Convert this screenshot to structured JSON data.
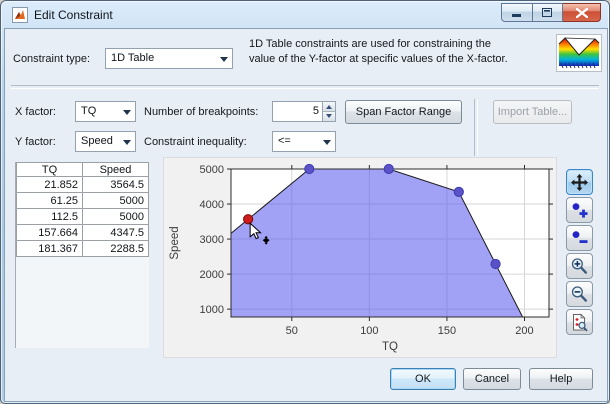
{
  "window": {
    "title": "Edit Constraint"
  },
  "header": {
    "constraint_type_label": "Constraint type:",
    "constraint_type_value": "1D Table",
    "description_line1": "1D Table constraints are used for constraining the",
    "description_line2": "value of the Y-factor at specific values of the X-factor."
  },
  "controls": {
    "x_factor_label": "X factor:",
    "x_factor_value": "TQ",
    "y_factor_label": "Y factor:",
    "y_factor_value": "Speed",
    "breakpoints_label": "Number of breakpoints:",
    "breakpoints_value": "5",
    "inequality_label": "Constraint inequality:",
    "inequality_value": "<=",
    "span_button": "Span Factor Range",
    "import_button": "Import Table..."
  },
  "table": {
    "headers": [
      "TQ",
      "Speed"
    ],
    "rows": [
      [
        "21.852",
        "3564.5"
      ],
      [
        "61.25",
        "5000"
      ],
      [
        "112.5",
        "5000"
      ],
      [
        "157.664",
        "4347.5"
      ],
      [
        "181.367",
        "2288.5"
      ]
    ]
  },
  "chart_data": {
    "type": "area",
    "xlabel": "TQ",
    "ylabel": "Speed",
    "x": [
      21.852,
      61.25,
      112.5,
      157.664,
      181.367
    ],
    "y": [
      3564.5,
      5000,
      5000,
      4347.5,
      2288.5
    ],
    "selected_point_index": 0,
    "xlim": [
      10.8,
      215.8
    ],
    "ylim": [
      775,
      5000
    ],
    "xticks": [
      50,
      100,
      150,
      200
    ],
    "yticks": [
      1000,
      2000,
      3000,
      4000,
      5000
    ],
    "grid": true,
    "legend": "none",
    "fill_color": "#5a5aee",
    "fill_opacity": 0.57,
    "line_color": "#1a1a1a",
    "marker_color": "#5b52c9",
    "selected_marker_color": "#cc1c1c"
  },
  "toolbar": {
    "buttons": [
      "pan",
      "add-point",
      "remove-point",
      "zoom-in",
      "zoom-out",
      "reset-zoom"
    ],
    "selected": "pan"
  },
  "footer": {
    "ok": "OK",
    "cancel": "Cancel",
    "help": "Help"
  },
  "colors": {
    "dialog_bg": "#e8eef6",
    "titlebar": "#b9d4ec",
    "close_button": "#cc4f35",
    "plot_bg": "#ffffff",
    "grid_line": "#d6d6d6"
  }
}
